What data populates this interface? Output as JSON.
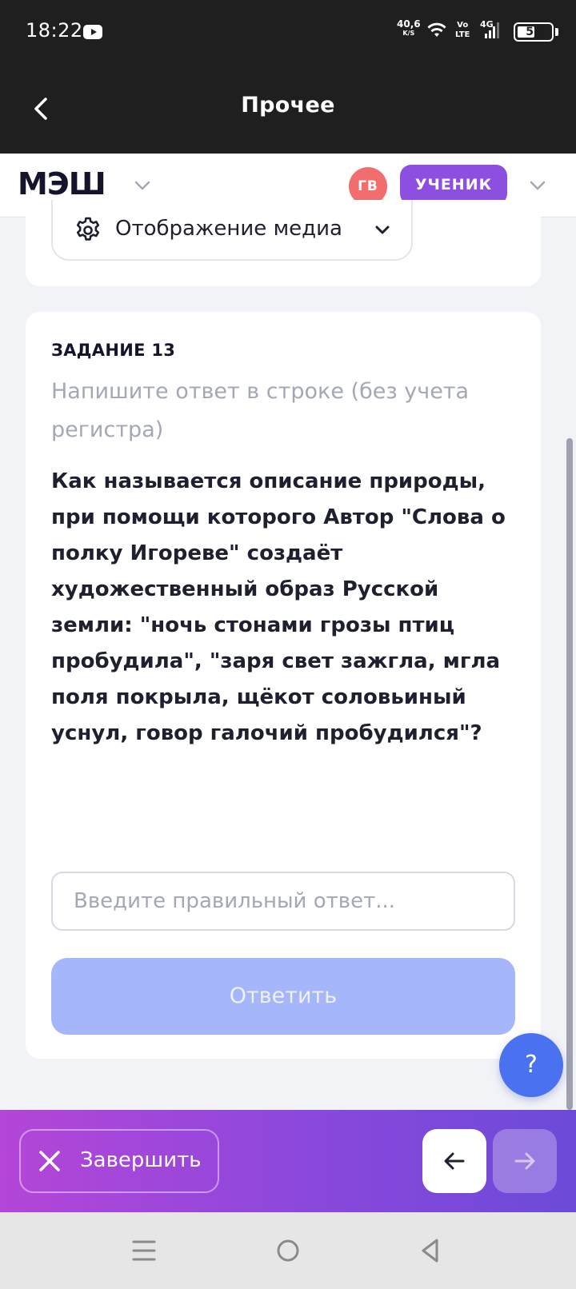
{
  "status_bar": {
    "time": "18:22",
    "net_speed": "40,6",
    "net_unit": "K/S",
    "volte_top": "Vo",
    "volte_bottom": "LTE",
    "network": "4G",
    "battery": "52",
    "battery_level": 0.52
  },
  "app_bar": {
    "title": "Прочее"
  },
  "header": {
    "logo": "МЭШ",
    "avatar_initials": "ГВ",
    "role": "УЧЕНИК"
  },
  "media": {
    "label": "Отображение медиа"
  },
  "task": {
    "label": "ЗАДАНИЕ 13",
    "hint": "Напишите ответ в строке (без учета регистра)",
    "question": "Как называется описание природы, при помощи которого Автор \"Слова о полку Игореве\" создаёт художественный образ Русской земли: \"ночь стонами грозы птиц пробудила\", \"заря свет зажгла, мгла поля покрыла, щёкот соловьиный уснул, говор галочий пробудился\"?",
    "input_placeholder": "Введите правильный ответ...",
    "input_value": "",
    "submit_label": "Ответить"
  },
  "help": {
    "label": "?"
  },
  "bottom_bar": {
    "finish_label": "Завершить"
  },
  "colors": {
    "accent_purple": "#8c4fe0",
    "submit_disabled": "#a6b6fa",
    "help_blue": "#4a72f0",
    "avatar_red": "#f26d6d"
  }
}
